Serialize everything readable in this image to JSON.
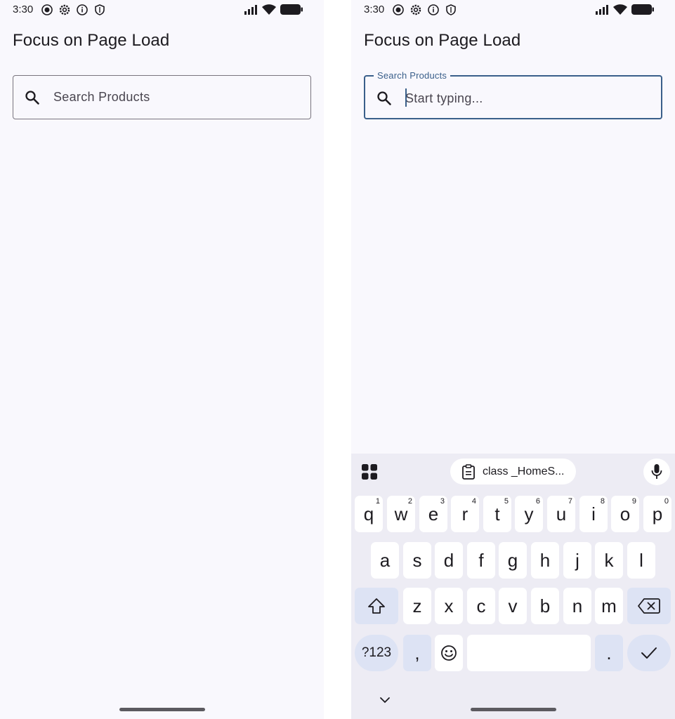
{
  "status_bar": {
    "time": "3:30"
  },
  "left_screen": {
    "title": "Focus on Page Load",
    "search": {
      "label": "Search Products",
      "icon": "search-icon"
    }
  },
  "right_screen": {
    "title": "Focus on Page Load",
    "search": {
      "label": "Search Products",
      "placeholder": "Start typing...",
      "value": "",
      "icon": "search-icon"
    },
    "keyboard": {
      "clipboard_suggestion": "class _HomeS...",
      "row1": [
        {
          "key": "q",
          "hint": "1"
        },
        {
          "key": "w",
          "hint": "2"
        },
        {
          "key": "e",
          "hint": "3"
        },
        {
          "key": "r",
          "hint": "4"
        },
        {
          "key": "t",
          "hint": "5"
        },
        {
          "key": "y",
          "hint": "6"
        },
        {
          "key": "u",
          "hint": "7"
        },
        {
          "key": "i",
          "hint": "8"
        },
        {
          "key": "o",
          "hint": "9"
        },
        {
          "key": "p",
          "hint": "0"
        }
      ],
      "row2": [
        "a",
        "s",
        "d",
        "f",
        "g",
        "h",
        "j",
        "k",
        "l"
      ],
      "row3": [
        "z",
        "x",
        "c",
        "v",
        "b",
        "n",
        "m"
      ],
      "symbols_key": "?123",
      "comma_key": ",",
      "period_key": "."
    }
  },
  "colors": {
    "background": "#f9f8fd",
    "accent": "#3a5f8a",
    "keyboard_bg": "#edecf4",
    "modifier_key": "#dde3f4"
  }
}
